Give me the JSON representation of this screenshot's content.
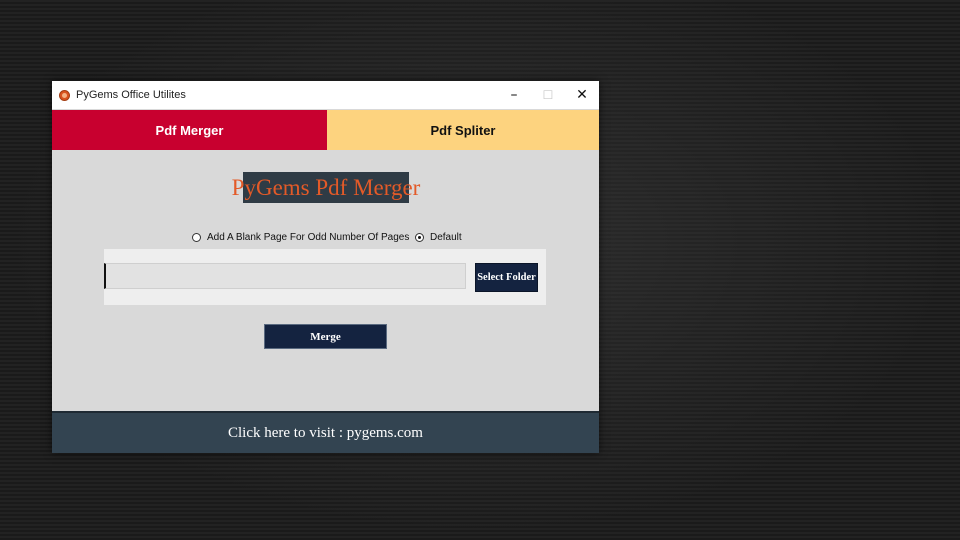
{
  "window": {
    "title": "PyGems Office Utilites",
    "icon": "pygems-logo-icon",
    "controls": {
      "minimize": "–",
      "maximize": "☐",
      "close": "✕"
    }
  },
  "tabs": [
    {
      "label": "Pdf Merger",
      "active": true,
      "color": "#c8002f"
    },
    {
      "label": "Pdf Spliter",
      "active": false,
      "color": "#fdd37f"
    }
  ],
  "main": {
    "heading": "PyGems Pdf Merger",
    "options": [
      {
        "label": "Add A Blank Page For Odd Number Of Pages",
        "checked": false
      },
      {
        "label": "Default",
        "checked": true
      }
    ],
    "folder_path": {
      "value": "",
      "placeholder": ""
    },
    "select_folder_label": "Select Folder",
    "merge_label": "Merge"
  },
  "footer": {
    "link_text": "Click here to visit : pygems.com"
  },
  "colors": {
    "accent_red": "#c8002f",
    "accent_yellow": "#fdd37f",
    "button_navy": "#142340",
    "footer_bg": "#334451",
    "heading_orange": "#e35a28"
  }
}
